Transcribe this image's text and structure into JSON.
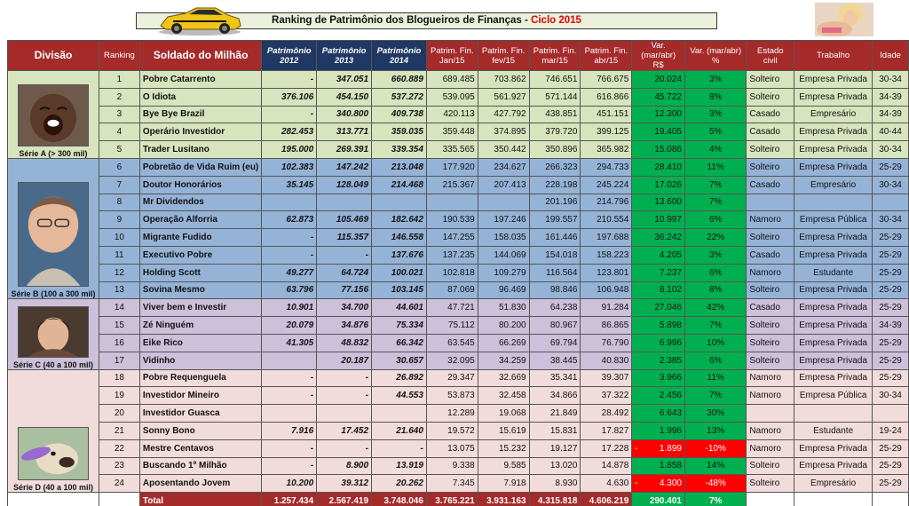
{
  "title": {
    "prefix": "Ranking de Patrimônio dos Blogueiros de Finanças - ",
    "accent": "Ciclo 2015"
  },
  "headers": {
    "divisao": "Divisão",
    "ranking": "Ranking",
    "soldado": "Soldado do Milhão",
    "p2012": "Patrimônio 2012",
    "p2013": "Patrimônio 2013",
    "p2014": "Patrimônio 2014",
    "jan": "Patrim. Fin. Jan/15",
    "fev": "Patrim. Fin. fev/15",
    "mar": "Patrim. Fin. mar/15",
    "abr": "Patrim. Fin. abr/15",
    "var_rs": "Var. (mar/abr) R$",
    "var_pct": "Var. (mar/abr) %",
    "estado": "Estado civil",
    "trabalho": "Trabalho",
    "idade": "Idade"
  },
  "divisions": [
    {
      "label": "Série A (> 300 mil)",
      "icon": "laughing-man-photo"
    },
    {
      "label": "Série B (100 a 300 mil)",
      "icon": "bald-man-photo"
    },
    {
      "label": "Série C (40 a 100 mil)",
      "icon": "young-man-photo"
    },
    {
      "label": "Série D (40 a 100 mil)",
      "icon": "dog-frisbee-photo"
    }
  ],
  "rows": [
    [
      "1",
      "Pobre Catarrento",
      "-",
      "347.051",
      "660.889",
      "689.485",
      "703.862",
      "746.651",
      "766.675",
      "20.024",
      "3%",
      "Solteiro",
      "Empresa Privada",
      "30-34"
    ],
    [
      "2",
      "O Idiota",
      "376.106",
      "454.150",
      "537.272",
      "539.095",
      "561.927",
      "571.144",
      "616.866",
      "45.722",
      "8%",
      "Solteiro",
      "Empresa Privada",
      "34-39"
    ],
    [
      "3",
      "Bye Bye Brazil",
      "-",
      "340.800",
      "409.738",
      "420.113",
      "427.792",
      "438.851",
      "451.151",
      "12.300",
      "3%",
      "Casado",
      "Empresário",
      "34-39"
    ],
    [
      "4",
      "Operário Investidor",
      "282.453",
      "313.771",
      "359.035",
      "359.448",
      "374.895",
      "379.720",
      "399.125",
      "19.405",
      "5%",
      "Casado",
      "Empresa Privada",
      "40-44"
    ],
    [
      "5",
      "Trader Lusitano",
      "195.000",
      "269.391",
      "339.354",
      "335.565",
      "350.442",
      "350.896",
      "365.982",
      "15.086",
      "4%",
      "Solteiro",
      "Empresa Privada",
      "30-34"
    ],
    [
      "6",
      "Pobretão de Vida Ruim (eu)",
      "102.383",
      "147.242",
      "213.048",
      "177.920",
      "234.627",
      "266.323",
      "294.733",
      "28.410",
      "11%",
      "Solteiro",
      "Empresa Privada",
      "25-29"
    ],
    [
      "7",
      "Doutor Honorários",
      "35.145",
      "128.049",
      "214.468",
      "215.367",
      "207.413",
      "228.198",
      "245.224",
      "17.026",
      "7%",
      "Casado",
      "Empresário",
      "30-34"
    ],
    [
      "8",
      "Mr Dividendos",
      "",
      "",
      "",
      "",
      "",
      "201.196",
      "214.796",
      "13.600",
      "7%",
      "",
      "",
      ""
    ],
    [
      "9",
      "Operação Alforria",
      "62.873",
      "105.469",
      "182.642",
      "190.539",
      "197.246",
      "199.557",
      "210.554",
      "10.997",
      "6%",
      "Namoro",
      "Empresa Pública",
      "30-34"
    ],
    [
      "10",
      "Migrante Fudido",
      "-",
      "115.357",
      "146.558",
      "147.255",
      "158.035",
      "161.446",
      "197.688",
      "36.242",
      "22%",
      "Solteiro",
      "Empresa Privada",
      "25-29"
    ],
    [
      "11",
      "Executivo Pobre",
      "-",
      "-",
      "137.676",
      "137.235",
      "144.069",
      "154.018",
      "158.223",
      "4.205",
      "3%",
      "Casado",
      "Empresa Privada",
      "25-29"
    ],
    [
      "12",
      "Holding Scott",
      "49.277",
      "64.724",
      "100.021",
      "102.818",
      "109.279",
      "116.564",
      "123.801",
      "7.237",
      "6%",
      "Namoro",
      "Estudante",
      "25-29"
    ],
    [
      "13",
      "Sovina Mesmo",
      "63.796",
      "77.156",
      "103.145",
      "87.069",
      "96.469",
      "98.846",
      "106.948",
      "8.102",
      "8%",
      "Solteiro",
      "Empresa Privada",
      "25-29"
    ],
    [
      "14",
      "Viver bem e Investir",
      "10.901",
      "34.700",
      "44.601",
      "47.721",
      "51.830",
      "64.238",
      "91.284",
      "27.046",
      "42%",
      "Casado",
      "Empresa Privada",
      "25-29"
    ],
    [
      "15",
      "Zé Ninguém",
      "20.079",
      "34.876",
      "75.334",
      "75.112",
      "80.200",
      "80.967",
      "86.865",
      "5.898",
      "7%",
      "Solteiro",
      "Empresa Privada",
      "34-39"
    ],
    [
      "16",
      "Eike Rico",
      "41.305",
      "48.832",
      "66.342",
      "63.545",
      "66.269",
      "69.794",
      "76.790",
      "6.996",
      "10%",
      "Solteiro",
      "Empresa Privada",
      "25-29"
    ],
    [
      "17",
      "Vidinho",
      "",
      "20.187",
      "30.657",
      "32.095",
      "34.259",
      "38.445",
      "40.830",
      "2.385",
      "6%",
      "Solteiro",
      "Empresa Privada",
      "25-29"
    ],
    [
      "18",
      "Pobre Requenguela",
      "-",
      "-",
      "26.892",
      "29.347",
      "32.669",
      "35.341",
      "39.307",
      "3.966",
      "11%",
      "Namoro",
      "Empresa Privada",
      "25-29"
    ],
    [
      "19",
      "Investidor Mineiro",
      "-",
      "-",
      "44.553",
      "53.873",
      "32.458",
      "34.866",
      "37.322",
      "2.456",
      "7%",
      "Namoro",
      "Empresa Pública",
      "30-34"
    ],
    [
      "20",
      "Investidor Guasca",
      "",
      "",
      "",
      "12.289",
      "19.068",
      "21.849",
      "28.492",
      "6.643",
      "30%",
      "",
      "",
      ""
    ],
    [
      "21",
      "Sonny Bono",
      "7.916",
      "17.452",
      "21.640",
      "19.572",
      "15.619",
      "15.831",
      "17.827",
      "1.996",
      "13%",
      "Namoro",
      "Estudante",
      "19-24"
    ],
    [
      "22",
      "Mestre Centavos",
      "-",
      "-",
      "-",
      "13.075",
      "15.232",
      "19.127",
      "17.228",
      "1.899",
      "-10%",
      "Namoro",
      "Empresa Privada",
      "25-29"
    ],
    [
      "23",
      "Buscando 1º Milhão",
      "-",
      "8.900",
      "13.919",
      "9.338",
      "9.585",
      "13.020",
      "14.878",
      "1.858",
      "14%",
      "Solteiro",
      "Empresa Privada",
      "25-29"
    ],
    [
      "24",
      "Aposentando Jovem",
      "10.200",
      "39.312",
      "20.262",
      "7.345",
      "7.918",
      "8.930",
      "4.630",
      "4.300",
      "-48%",
      "Solteiro",
      "Empresário",
      "25-29"
    ]
  ],
  "negative_marks": {
    "22": "-",
    "24": "-"
  },
  "total": {
    "label": "Total",
    "p2012": "1.257.434",
    "p2013": "2.567.419",
    "p2014": "3.748.046",
    "jan": "3.765.221",
    "fev": "3.931.163",
    "mar": "4.315.818",
    "abr": "4.606.219",
    "var_rs": "290.401",
    "var_pct": "7%"
  },
  "colors": {
    "header": "#a52a2a",
    "header_navy": "#1f3864",
    "serie_a": "#d7e4bd",
    "serie_b": "#95b3d7",
    "serie_c": "#ccc0da",
    "serie_d": "#f2dcdb",
    "positive": "#00b050",
    "negative": "#ff0000"
  }
}
